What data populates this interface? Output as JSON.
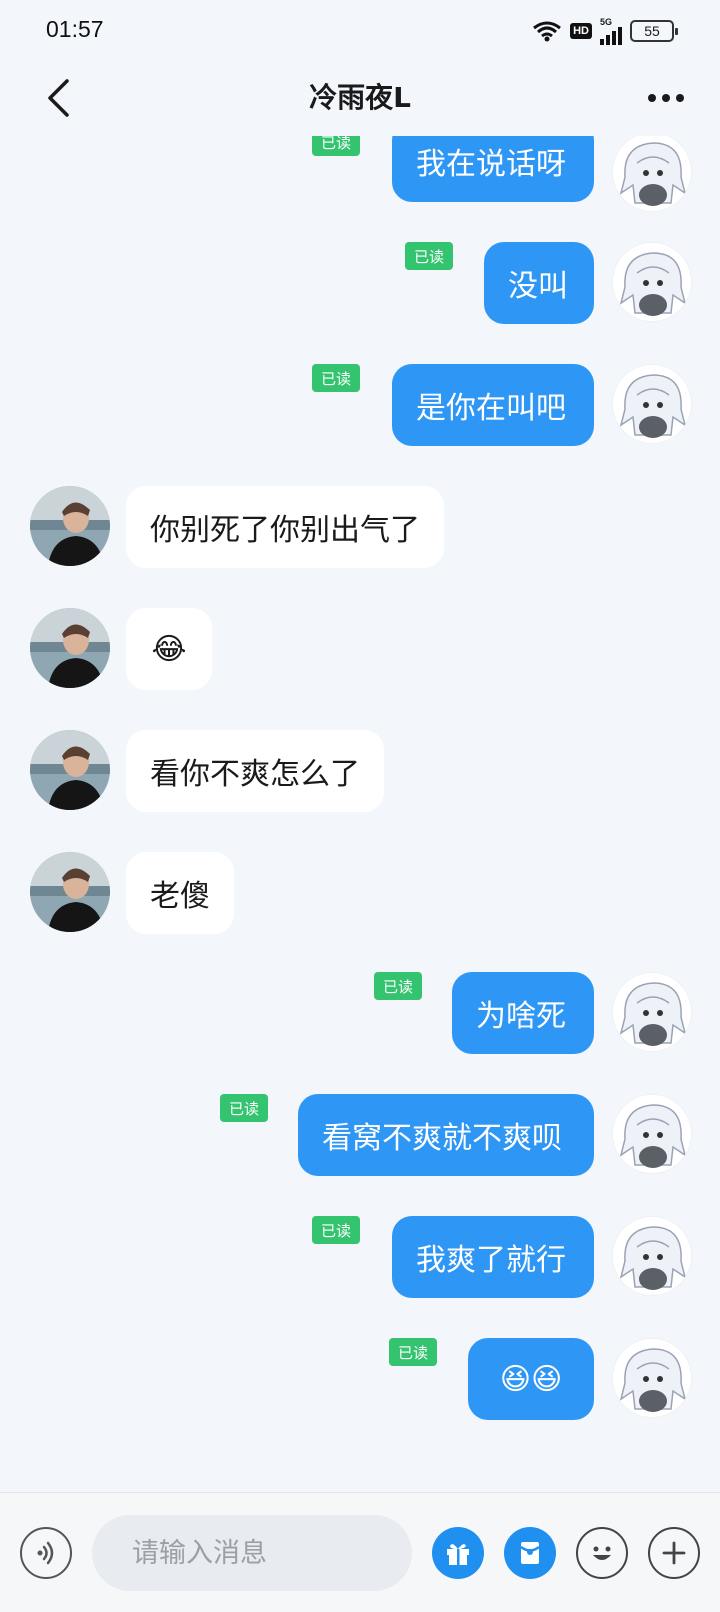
{
  "status_bar": {
    "time": "01:57",
    "hd": "HD",
    "network": "5G",
    "battery": "55"
  },
  "header": {
    "title": "冷雨夜L"
  },
  "messages": [
    {
      "side": "out",
      "text": "我在说话呀",
      "read": "已读"
    },
    {
      "side": "out",
      "text": "没叫",
      "read": "已读"
    },
    {
      "side": "out",
      "text": "是你在叫吧",
      "read": "已读"
    },
    {
      "side": "in",
      "text": "你别死了你别出气了"
    },
    {
      "side": "in",
      "text": "😂"
    },
    {
      "side": "in",
      "text": "看你不爽怎么了"
    },
    {
      "side": "in",
      "text": "老傻"
    },
    {
      "side": "out",
      "text": "为啥死",
      "read": "已读"
    },
    {
      "side": "out",
      "text": "看窝不爽就不爽呗",
      "read": "已读"
    },
    {
      "side": "out",
      "text": "我爽了就行",
      "read": "已读"
    },
    {
      "side": "out",
      "text": "😆😆",
      "read": "已读"
    }
  ],
  "input": {
    "placeholder": "请输入消息"
  },
  "colors": {
    "bubble_out": "#2e96f5",
    "bubble_in": "#ffffff",
    "read_badge": "#34c46f",
    "background": "#f3f6fa"
  },
  "icons": {
    "back": "chevron-left-icon",
    "more": "more-dots-icon",
    "voice": "voice-icon",
    "gift": "gift-icon",
    "red_packet": "red-packet-icon",
    "emoji": "emoji-icon",
    "plus": "plus-icon"
  }
}
